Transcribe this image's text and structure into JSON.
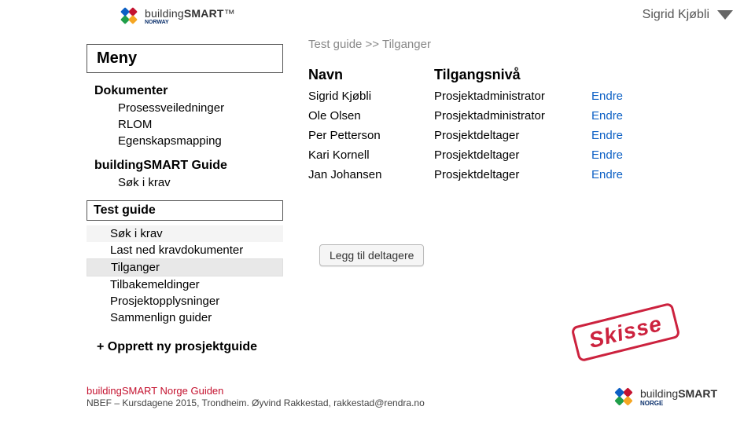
{
  "header": {
    "brand_prefix": "building",
    "brand_bold": "SMART",
    "brand_tm": "™",
    "brand_region": "NORWAY",
    "user_name": "Sigrid Kjøbli"
  },
  "sidebar": {
    "menu_label": "Meny",
    "group1": {
      "heading": "Dokumenter",
      "items": [
        "Prosessveiledninger",
        "RLOM",
        "Egenskapsmapping"
      ]
    },
    "group2": {
      "heading": "buildingSMART Guide",
      "items": [
        "Søk i krav"
      ]
    },
    "group3": {
      "heading": "Test guide",
      "items": [
        "Søk i krav",
        "Last ned kravdokumenter",
        "Tilganger",
        "Tilbakemeldinger",
        "Prosjektopplysninger",
        "Sammenlign guider"
      ]
    },
    "create_new": "+ Opprett ny prosjektguide"
  },
  "main": {
    "breadcrumb": "Test guide >> Tilganger",
    "col_name": "Navn",
    "col_level": "Tilgangsnivå",
    "action_label": "Endre",
    "rows": [
      {
        "name": "Sigrid Kjøbli",
        "level": "Prosjektadministrator"
      },
      {
        "name": "Ole Olsen",
        "level": "Prosjektadministrator"
      },
      {
        "name": "Per Petterson",
        "level": "Prosjektdeltager"
      },
      {
        "name": "Kari Kornell",
        "level": "Prosjektdeltager"
      },
      {
        "name": "Jan Johansen",
        "level": "Prosjektdeltager"
      }
    ],
    "add_button": "Legg til deltagere"
  },
  "stamp": "Skisse",
  "footer": {
    "title": "buildingSMART Norge Guiden",
    "sub": "NBEF – Kursdagene 2015, Trondheim. Øyvind Rakkestad, rakkestad@rendra.no",
    "brand_prefix": "building",
    "brand_bold": "SMART",
    "brand_region": "NORGE"
  }
}
